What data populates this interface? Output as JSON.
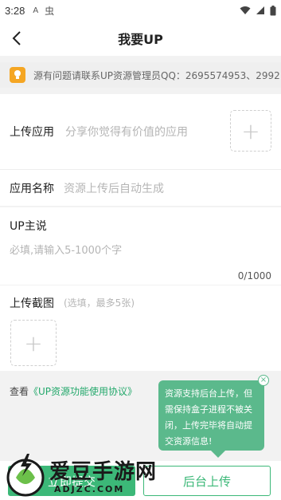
{
  "status_bar": {
    "time": "3:28",
    "icon_a": "A",
    "icon_b": "虫"
  },
  "header": {
    "title": "我要UP"
  },
  "notice": {
    "text": "源有问题请联系UP资源管理员QQ：2695574953、2992"
  },
  "upload_app": {
    "label": "上传应用",
    "placeholder": "分享你觉得有价值的应用",
    "plus": "+"
  },
  "app_name": {
    "label": "应用名称",
    "placeholder": "资源上传后自动生成"
  },
  "up_says": {
    "label": "UP主说",
    "placeholder": "必填,请输入5-1000个字",
    "counter": "0/1000"
  },
  "screenshots": {
    "label": "上传截图",
    "hint": "(选填，最多5张)",
    "plus": "+"
  },
  "agreement": {
    "prefix": "查看",
    "link": "《UP资源功能使用协议》"
  },
  "tooltip": {
    "text": "资源支持后台上传，但需保持盒子进程不被关闭，上传完毕将自动提交资源信息!",
    "close": "×"
  },
  "buttons": {
    "submit": "立即提交",
    "background_upload": "后台上传"
  },
  "watermark": {
    "brand": "爱豆手游网",
    "url": "ADJZC.COM"
  },
  "colors": {
    "accent": "#3cb878",
    "tooltip": "#5bb98c",
    "notice_icon": "#f5a623"
  }
}
